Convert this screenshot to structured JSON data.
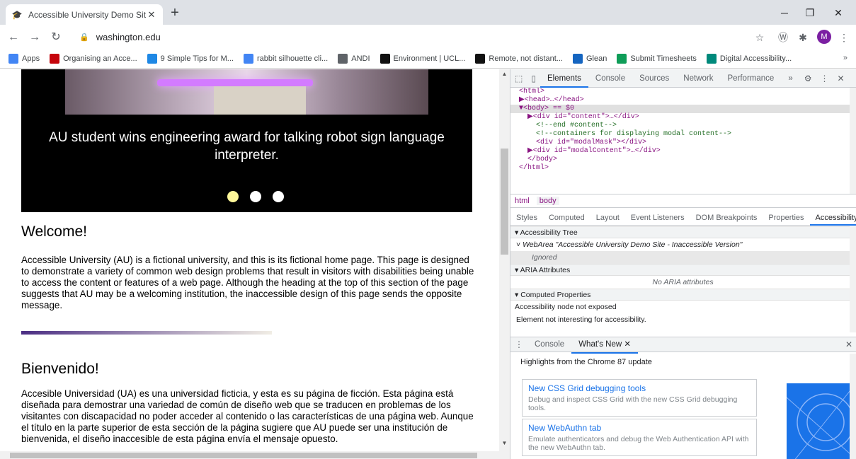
{
  "browser": {
    "tab_title": "Accessible University Demo Site",
    "url": "washington.edu",
    "profile_initial": "M",
    "bookmarks": [
      {
        "label": "Apps",
        "icon": "apps-grid-icon",
        "color": "#4285f4"
      },
      {
        "label": "Organising an Acce...",
        "icon": "bookmark-favicon",
        "color": "#c5050c"
      },
      {
        "label": "9 Simple Tips for M...",
        "icon": "bookmark-favicon",
        "color": "#1e88e5"
      },
      {
        "label": "rabbit silhouette cli...",
        "icon": "google-icon",
        "color": "#4285f4"
      },
      {
        "label": "ANDI",
        "icon": "globe-icon",
        "color": "#5f6368"
      },
      {
        "label": "Environment | UCL...",
        "icon": "ucl-icon",
        "color": "#111111"
      },
      {
        "label": "Remote, not distant...",
        "icon": "ucl-icon",
        "color": "#111111"
      },
      {
        "label": "Glean",
        "icon": "glean-icon",
        "color": "#1565c0"
      },
      {
        "label": "Submit Timesheets",
        "icon": "timesheet-icon",
        "color": "#0f9d58"
      },
      {
        "label": "Digital Accessibility...",
        "icon": "digital-icon",
        "color": "#00897b"
      }
    ],
    "more_bookmarks": "»"
  },
  "page": {
    "caption": "AU student wins engineering award for talking robot sign language interpreter.",
    "welcome_heading": "Welcome!",
    "welcome_text": "Accessible University (AU) is a fictional university, and this is its fictional home page. This page is designed to demonstrate a variety of common web design problems that result in visitors with disabilities being unable to access the content or features of a web page. Although the heading at the top of this section of the page suggests that AU may be a welcoming institution, the inaccessible design of this page sends the opposite message.",
    "bienvenido_heading": "Bienvenido!",
    "bienvenido_text": "Accesible Universidad (UA) es una universidad ficticia, y esta es su página de ficción. Esta página está diseñada para demostrar una variedad de común de diseño web que se traducen en problemas de los visitantes con discapacidad no poder acceder al contenido o las características de una página web. Aunque el título en la parte superior de esta sección de la página sugiere que AU puede ser una institución de bienvenida, el diseño inaccesible de esta página envía el mensaje opuesto."
  },
  "devtools": {
    "tabs": [
      "Elements",
      "Console",
      "Sources",
      "Network",
      "Performance"
    ],
    "active_tab": "Elements",
    "more": "»",
    "dom": [
      {
        "t": "<html>",
        "sel": false
      },
      {
        "t": "▶<head>…</head>",
        "sel": false
      },
      {
        "t": "▼<body> == $0",
        "sel": true
      },
      {
        "t": "  ▶<div id=\"content\">…</div>",
        "sel": false
      },
      {
        "t": "    <!--end #content-->",
        "sel": false
      },
      {
        "t": "    <!--containers for displaying modal content-->",
        "sel": false
      },
      {
        "t": "    <div id=\"modalMask\"></div>",
        "sel": false
      },
      {
        "t": "  ▶<div id=\"modalContent\">…</div>",
        "sel": false
      },
      {
        "t": "  </body>",
        "sel": false
      },
      {
        "t": "</html>",
        "sel": false
      }
    ],
    "crumbs": [
      "html",
      "body"
    ],
    "subtabs": [
      "Styles",
      "Computed",
      "Layout",
      "Event Listeners",
      "DOM Breakpoints",
      "Properties",
      "Accessibility"
    ],
    "active_subtab": "Accessibility",
    "acc_tree_title": "Accessibility Tree",
    "webarea": "WebArea \"Accessible University Demo Site - Inaccessible Version\"",
    "ignored": "Ignored",
    "aria_title": "ARIA Attributes",
    "no_aria": "No ARIA attributes",
    "computed_title": "Computed Properties",
    "not_exposed": "Accessibility node not exposed",
    "not_interesting": "Element not interesting for accessibility.",
    "drawer_tabs": [
      "Console",
      "What's New"
    ],
    "highlights": "Highlights from the Chrome 87 update",
    "cards": [
      {
        "title": "New CSS Grid debugging tools",
        "desc": "Debug and inspect CSS Grid with the new CSS Grid debugging tools."
      },
      {
        "title": "New WebAuthn tab",
        "desc": "Emulate authenticators and debug the Web Authentication API with the new WebAuthn tab."
      }
    ]
  }
}
